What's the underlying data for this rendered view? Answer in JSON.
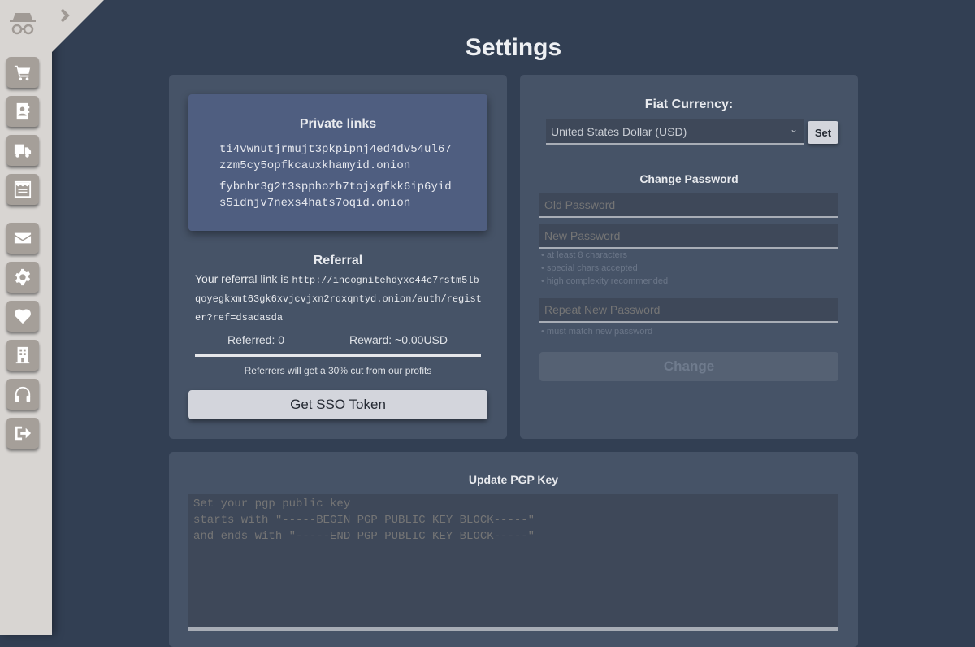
{
  "page_title": "Settings",
  "sidebar": {
    "items": [
      {
        "icon": "cart-icon"
      },
      {
        "icon": "contacts-icon"
      },
      {
        "icon": "truck-icon"
      },
      {
        "icon": "receipt-icon"
      },
      {
        "icon": "envelope-icon"
      },
      {
        "icon": "gear-icon"
      },
      {
        "icon": "heart-icon"
      },
      {
        "icon": "building-icon"
      },
      {
        "icon": "headphones-icon"
      },
      {
        "icon": "logout-icon"
      }
    ]
  },
  "private_links": {
    "title": "Private links",
    "links": [
      "ti4vwnutjrmujt3pkpipnj4ed4dv54ul67zzm5cy5opfkcauxkhamyid.onion",
      "fybnbr3g2t3spphozb7tojxgfkk6ip6yids5idnjv7nexs4hats7oqid.onion"
    ]
  },
  "referral": {
    "title": "Referral",
    "prefix": "Your referral link is ",
    "link": "http://incognitehdyxc44c7rstm5lbqoyegkxmt63gk6xvjcvjxn2rqxqntyd.onion/auth/register?ref=dsadasda",
    "referred": "Referred: 0",
    "reward": "Reward: ~0.00USD",
    "note": "Referrers will get a 30% cut from our profits",
    "sso_button": "Get SSO Token"
  },
  "currency": {
    "title": "Fiat Currency:",
    "selected": "United States Dollar (USD)",
    "set_button": "Set"
  },
  "password": {
    "title": "Change Password",
    "old_placeholder": "Old Password",
    "new_placeholder": "New Password",
    "hints": [
      "• at least 8 characters",
      "• special chars accepted",
      "• high complexity recommended"
    ],
    "repeat_placeholder": "Repeat New Password",
    "repeat_hint": "• must match new password",
    "change_button": "Change"
  },
  "pgp": {
    "title": "Update PGP Key",
    "placeholder": "Set your pgp public key\nstarts with \"-----BEGIN PGP PUBLIC KEY BLOCK-----\"\nand ends with \"-----END PGP PUBLIC KEY BLOCK-----\""
  }
}
